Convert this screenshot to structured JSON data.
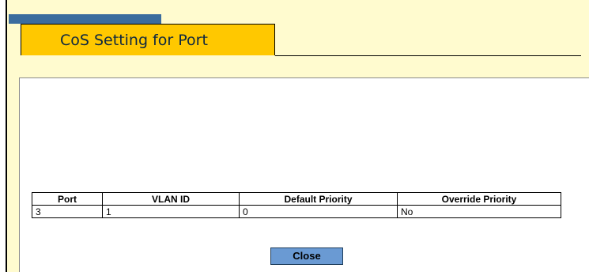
{
  "title": "CoS Setting for Port",
  "table": {
    "headers": [
      "Port",
      "VLAN ID",
      "Default Priority",
      "Override Priority"
    ],
    "rows": [
      [
        "3",
        "1",
        "0",
        "No"
      ]
    ]
  },
  "buttons": {
    "close_label": "Close"
  },
  "colors": {
    "page_background": "#fffbcf",
    "title_tab": "#ffc800",
    "tab_strip": "#3b6c9e",
    "button": "#6a9ad3"
  }
}
